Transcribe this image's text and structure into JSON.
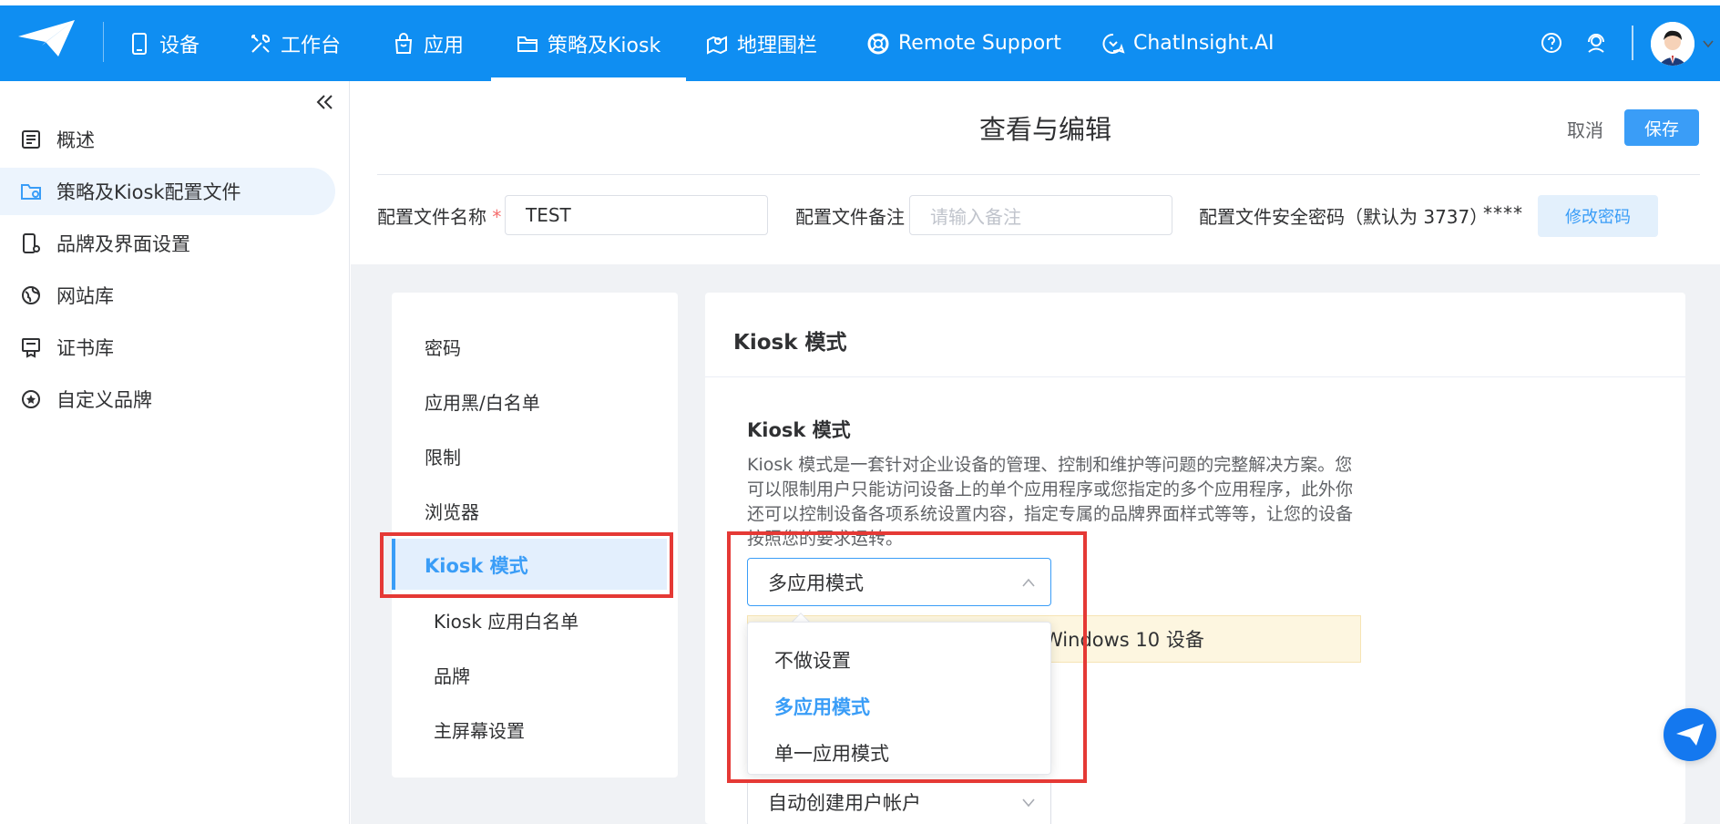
{
  "nav": {
    "items": [
      {
        "label": "设备",
        "icon": "device-icon"
      },
      {
        "label": "工作台",
        "icon": "tools-icon"
      },
      {
        "label": "应用",
        "icon": "app-bag-icon"
      },
      {
        "label": "策略及Kiosk",
        "icon": "folder-icon"
      },
      {
        "label": "地理围栏",
        "icon": "map-pin-icon"
      },
      {
        "label": "Remote Support",
        "icon": "lifebuoy-icon"
      },
      {
        "label": "ChatInsight.AI",
        "icon": "chat-ai-icon"
      }
    ],
    "active_index": 3,
    "help_icon": "help-circle-icon",
    "support_icon": "headset-icon"
  },
  "sidebar": {
    "items": [
      {
        "label": "概述",
        "icon": "overview-icon"
      },
      {
        "label": "策略及Kiosk配置文件",
        "icon": "folder-settings-icon"
      },
      {
        "label": "品牌及界面设置",
        "icon": "phone-settings-icon"
      },
      {
        "label": "网站库",
        "icon": "globe-icon"
      },
      {
        "label": "证书库",
        "icon": "certificate-icon"
      },
      {
        "label": "自定义品牌",
        "icon": "star-circle-icon"
      }
    ],
    "active_index": 1
  },
  "header": {
    "title": "查看与编辑",
    "cancel": "取消",
    "save": "保存"
  },
  "form": {
    "name_label": "配置文件名称",
    "name_required_mark": "*",
    "name_value": "TEST",
    "note_label": "配置文件备注",
    "note_placeholder": "请输入备注",
    "password_label": "配置文件安全密码（默认为 3737）",
    "password_masked": "****",
    "change_password": "修改密码"
  },
  "submenu": {
    "items": [
      "密码",
      "应用黑/白名单",
      "限制",
      "浏览器",
      "Kiosk 模式",
      "Kiosk 应用白名单",
      "品牌",
      "主屏幕设置"
    ],
    "active": "Kiosk 模式"
  },
  "panel": {
    "title": "Kiosk 模式",
    "section_title": "Kiosk 模式",
    "description": "Kiosk 模式是一套针对企业设备的管理、控制和维护等问题的完整解决方案。您可以限制用户只能访问设备上的单个应用程序或您指定的多个应用程序，此外你还可以控制设备各项系统设置内容，指定专属的品牌界面样式等等，让您的设备按照您的要求运转。",
    "mode_select": "多应用模式",
    "notice_text": "Windows 10 设备",
    "account_select": "自动创建用户帐户"
  },
  "dropdown": {
    "options": [
      "不做设置",
      "多应用模式",
      "单一应用模式"
    ],
    "selected": "多应用模式"
  },
  "colors": {
    "brand": "#0f8ef2",
    "accent": "#3a9df7",
    "highlight": "#e53935",
    "notice_bg": "#fdf6e0"
  }
}
